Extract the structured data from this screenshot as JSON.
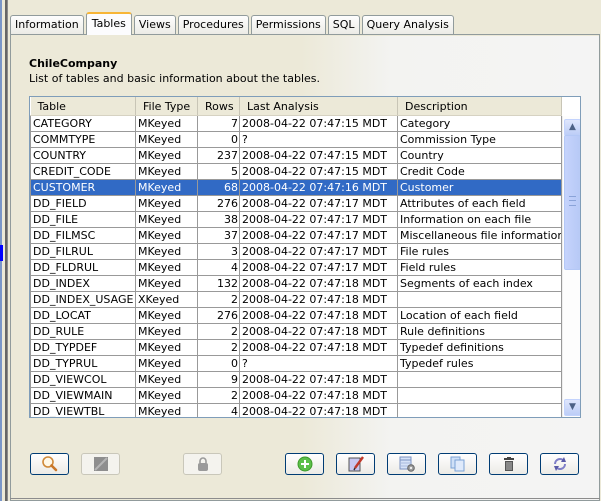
{
  "tabs": [
    {
      "label": "Information",
      "active": false
    },
    {
      "label": "Tables",
      "active": true
    },
    {
      "label": "Views",
      "active": false
    },
    {
      "label": "Procedures",
      "active": false
    },
    {
      "label": "Permissions",
      "active": false
    },
    {
      "label": "SQL",
      "active": false
    },
    {
      "label": "Query Analysis",
      "active": false
    }
  ],
  "header": {
    "title": "ChileCompany",
    "subtitle": "List of tables and basic information about the tables."
  },
  "grid": {
    "columns": [
      "Table",
      "File Type",
      "Rows",
      "Last Analysis",
      "Description"
    ],
    "selected_row": "CUSTOMER",
    "rows": [
      [
        "CATEGORY",
        "MKeyed",
        "7",
        "2008-04-22 07:47:15 MDT",
        "Category"
      ],
      [
        "COMMTYPE",
        "MKeyed",
        "0",
        "?",
        "Commission Type"
      ],
      [
        "COUNTRY",
        "MKeyed",
        "237",
        "2008-04-22 07:47:15 MDT",
        "Country"
      ],
      [
        "CREDIT_CODE",
        "MKeyed",
        "5",
        "2008-04-22 07:47:15 MDT",
        "Credit Code"
      ],
      [
        "CUSTOMER",
        "MKeyed",
        "68",
        "2008-04-22 07:47:16 MDT",
        "Customer"
      ],
      [
        "DD_FIELD",
        "MKeyed",
        "276",
        "2008-04-22 07:47:17 MDT",
        "Attributes of each field"
      ],
      [
        "DD_FILE",
        "MKeyed",
        "38",
        "2008-04-22 07:47:17 MDT",
        "Information on each file"
      ],
      [
        "DD_FILMSC",
        "MKeyed",
        "37",
        "2008-04-22 07:47:17 MDT",
        "Miscellaneous file information"
      ],
      [
        "DD_FILRUL",
        "MKeyed",
        "3",
        "2008-04-22 07:47:17 MDT",
        "File rules"
      ],
      [
        "DD_FLDRUL",
        "MKeyed",
        "4",
        "2008-04-22 07:47:17 MDT",
        "Field rules"
      ],
      [
        "DD_INDEX",
        "MKeyed",
        "132",
        "2008-04-22 07:47:18 MDT",
        "Segments of each index"
      ],
      [
        "DD_INDEX_USAGE",
        "XKeyed",
        "2",
        "2008-04-22 07:47:18 MDT",
        ""
      ],
      [
        "DD_LOCAT",
        "MKeyed",
        "276",
        "2008-04-22 07:47:18 MDT",
        "Location of each field"
      ],
      [
        "DD_RULE",
        "MKeyed",
        "2",
        "2008-04-22 07:47:18 MDT",
        "Rule definitions"
      ],
      [
        "DD_TYPDEF",
        "MKeyed",
        "2",
        "2008-04-22 07:47:18 MDT",
        "Typedef definitions"
      ],
      [
        "DD_TYPRUL",
        "MKeyed",
        "0",
        "?",
        "Typedef rules"
      ],
      [
        "DD_VIEWCOL",
        "MKeyed",
        "9",
        "2008-04-22 07:47:18 MDT",
        ""
      ],
      [
        "DD_VIEWMAIN",
        "MKeyed",
        "2",
        "2008-04-22 07:47:18 MDT",
        ""
      ],
      [
        "DD_VIEWTBL",
        "MKeyed",
        "4",
        "2008-04-22 07:47:18 MDT",
        ""
      ]
    ]
  },
  "toolbar": {
    "buttons": [
      {
        "name": "inspect",
        "icon": "magnifier-icon",
        "enabled": true
      },
      {
        "name": "edit-data",
        "icon": "grid-edit-icon",
        "enabled": false
      },
      {
        "name": "lock",
        "icon": "lock-icon",
        "enabled": false
      },
      {
        "name": "add",
        "icon": "add-icon",
        "enabled": true
      },
      {
        "name": "edit",
        "icon": "edit-pencil-icon",
        "enabled": true
      },
      {
        "name": "properties",
        "icon": "table-settings-icon",
        "enabled": true
      },
      {
        "name": "copy",
        "icon": "copy-icon",
        "enabled": true
      },
      {
        "name": "delete",
        "icon": "trash-icon",
        "enabled": true
      },
      {
        "name": "refresh",
        "icon": "refresh-icon",
        "enabled": true
      }
    ]
  },
  "colors": {
    "selection": "#316ac5",
    "active_tab_accent": "#f7b536",
    "panel_bg": "#ECE9D8",
    "grid_border": "#7f9db9"
  }
}
